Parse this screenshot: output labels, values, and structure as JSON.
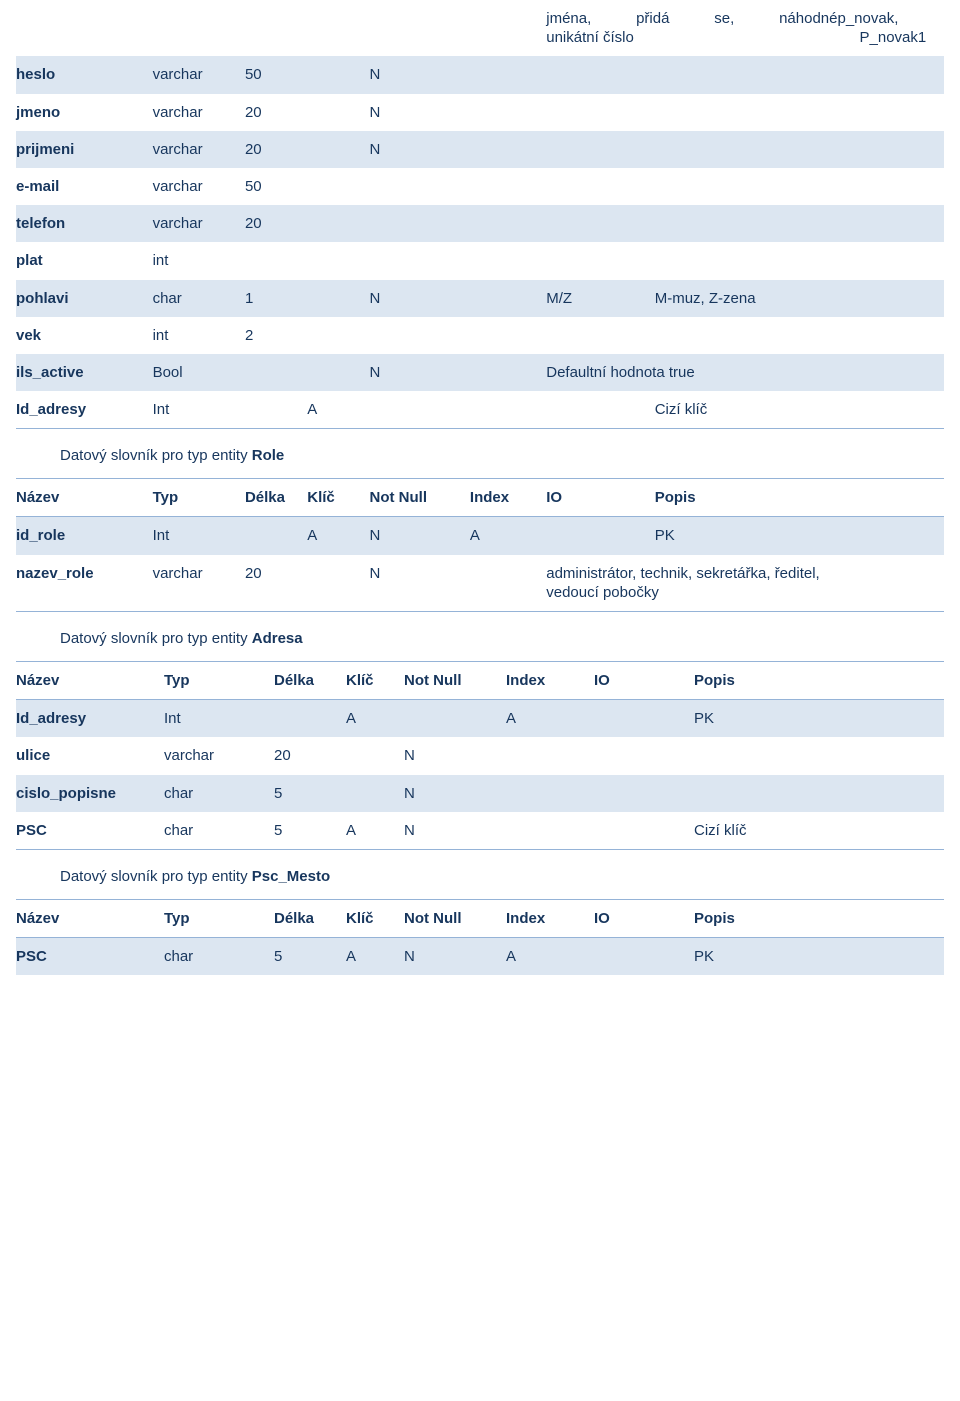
{
  "doc": {
    "continuation_row": {
      "name": "",
      "type": "",
      "len": "",
      "key": "",
      "notnull": "",
      "index": "",
      "io": "",
      "desc_line1": "jména, přidá se, náhodné",
      "desc_line2": "unikátní číslo",
      "io_line1": "p_novak,",
      "io_line2": "P_novak1"
    },
    "table_uzivatel": {
      "rows": [
        {
          "name": "heslo",
          "type": "varchar",
          "len": "50",
          "key": "",
          "notnull": "N",
          "index": "",
          "io": "",
          "desc": ""
        },
        {
          "name": "jmeno",
          "type": "varchar",
          "len": "20",
          "key": "",
          "notnull": "N",
          "index": "",
          "io": "",
          "desc": ""
        },
        {
          "name": "prijmeni",
          "type": "varchar",
          "len": "20",
          "key": "",
          "notnull": "N",
          "index": "",
          "io": "",
          "desc": ""
        },
        {
          "name": "e-mail",
          "type": "varchar",
          "len": "50",
          "key": "",
          "notnull": "",
          "index": "",
          "io": "",
          "desc": ""
        },
        {
          "name": "telefon",
          "type": "varchar",
          "len": "20",
          "key": "",
          "notnull": "",
          "index": "",
          "io": "",
          "desc": ""
        },
        {
          "name": "plat",
          "type": "int",
          "len": "",
          "key": "",
          "notnull": "",
          "index": "",
          "io": "",
          "desc": ""
        },
        {
          "name": "pohlavi",
          "type": "char",
          "len": "1",
          "key": "",
          "notnull": "N",
          "index": "",
          "io": "M/Z",
          "desc": "M-muz,  Z-zena"
        },
        {
          "name": "vek",
          "type": "int",
          "len": "2",
          "key": "",
          "notnull": "",
          "index": "",
          "io": "",
          "desc": ""
        },
        {
          "name": "ils_active",
          "type": "Bool",
          "len": "",
          "key": "",
          "notnull": "N",
          "index": "",
          "io": "Defaultní hodnota true",
          "desc": ""
        },
        {
          "name": "Id_adresy",
          "type": "Int",
          "len": "",
          "key": "A",
          "notnull": "",
          "index": "",
          "io": "",
          "desc": "Cizí klíč"
        }
      ]
    },
    "section_role": {
      "caption_prefix": "Datový slovník pro typ entity ",
      "caption_entity": "Role",
      "headers": {
        "name": "Název",
        "type": "Typ",
        "len": "Délka",
        "key": "Klíč",
        "notnull": "Not Null",
        "index": "Index",
        "io": "IO",
        "desc": "Popis"
      },
      "rows": [
        {
          "name": "id_role",
          "type": "Int",
          "len": "",
          "key": "A",
          "notnull": "N",
          "index": "A",
          "io": "",
          "desc": "PK"
        },
        {
          "name": "nazev_role",
          "type": "varchar",
          "len": "20",
          "key": "",
          "notnull": "N",
          "index": "",
          "io": "administrátor, technik, sekretářka, ředitel, vedoucí pobočky",
          "desc": ""
        }
      ]
    },
    "section_adresa": {
      "caption_prefix": "Datový slovník pro typ entity ",
      "caption_entity": "Adresa",
      "headers": {
        "name": "Název",
        "type": "Typ",
        "len": "Délka",
        "key": "Klíč",
        "notnull": "Not Null",
        "index": "Index",
        "io": "IO",
        "desc": "Popis"
      },
      "rows": [
        {
          "name": "Id_adresy",
          "type": "Int",
          "len": "",
          "key": "A",
          "notnull": "",
          "index": "A",
          "io": "",
          "desc": "PK"
        },
        {
          "name": "ulice",
          "type": "varchar",
          "len": "20",
          "key": "",
          "notnull": "N",
          "index": "",
          "io": "",
          "desc": ""
        },
        {
          "name": "cislo_popisne",
          "type": "char",
          "len": "5",
          "key": "",
          "notnull": "N",
          "index": "",
          "io": "",
          "desc": ""
        },
        {
          "name": "PSC",
          "type": "char",
          "len": "5",
          "key": "A",
          "notnull": "N",
          "index": "",
          "io": "",
          "desc": "Cizí klíč"
        }
      ]
    },
    "section_psc_mesto": {
      "caption_prefix": "Datový slovník pro typ entity ",
      "caption_entity": "Psc_Mesto",
      "headers": {
        "name": "Název",
        "type": "Typ",
        "len": "Délka",
        "key": "Klíč",
        "notnull": "Not Null",
        "index": "Index",
        "io": "IO",
        "desc": "Popis"
      },
      "rows": [
        {
          "name": "PSC",
          "type": "char",
          "len": "5",
          "key": "A",
          "notnull": "N",
          "index": "A",
          "io": "",
          "desc": "PK"
        }
      ]
    }
  }
}
